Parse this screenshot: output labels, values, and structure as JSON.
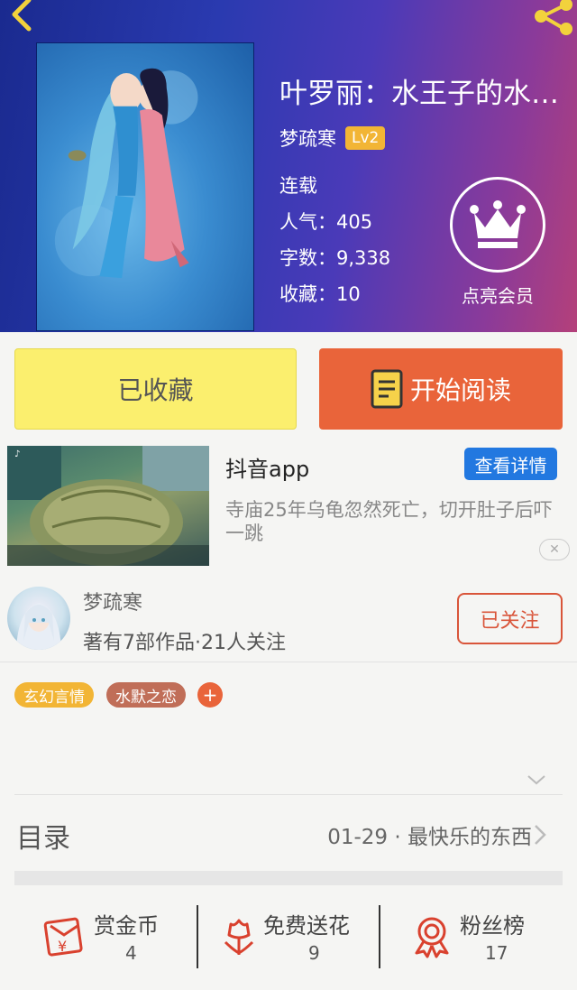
{
  "book": {
    "title": "叶罗丽：水王子的水…",
    "author": "梦疏寒",
    "level": "Lv2",
    "status": "连载",
    "popularity": "人气：405",
    "word_count": "字数：9,338",
    "favorites": "收藏：10"
  },
  "vip": {
    "label": "点亮会员"
  },
  "actions": {
    "favorited": "已收藏",
    "start_reading": "开始阅读"
  },
  "ad": {
    "title": "抖音app",
    "detail_button": "查看详情",
    "description": "寺庙25年乌龟忽然死亡，切开肚子后吓一跳",
    "close": "✕"
  },
  "author_card": {
    "name": "梦疏寒",
    "info": "著有7部作品·21人关注",
    "follow_button": "已关注"
  },
  "tags": [
    "玄幻言情",
    "水默之恋"
  ],
  "tag_add": "+",
  "toc": {
    "label": "目录",
    "latest": "01-29 · 最快乐的东西"
  },
  "bottom": [
    {
      "label": "赏金币",
      "count": "4"
    },
    {
      "label": "免费送花",
      "count": "9"
    },
    {
      "label": "粉丝榜",
      "count": "17"
    }
  ],
  "colors": {
    "accent": "#e9643a",
    "favorite": "#fbef6e",
    "level": "#f2b535",
    "ad_button": "#2278e0",
    "tag1": "#f2b535",
    "tag2": "#c06e58"
  }
}
